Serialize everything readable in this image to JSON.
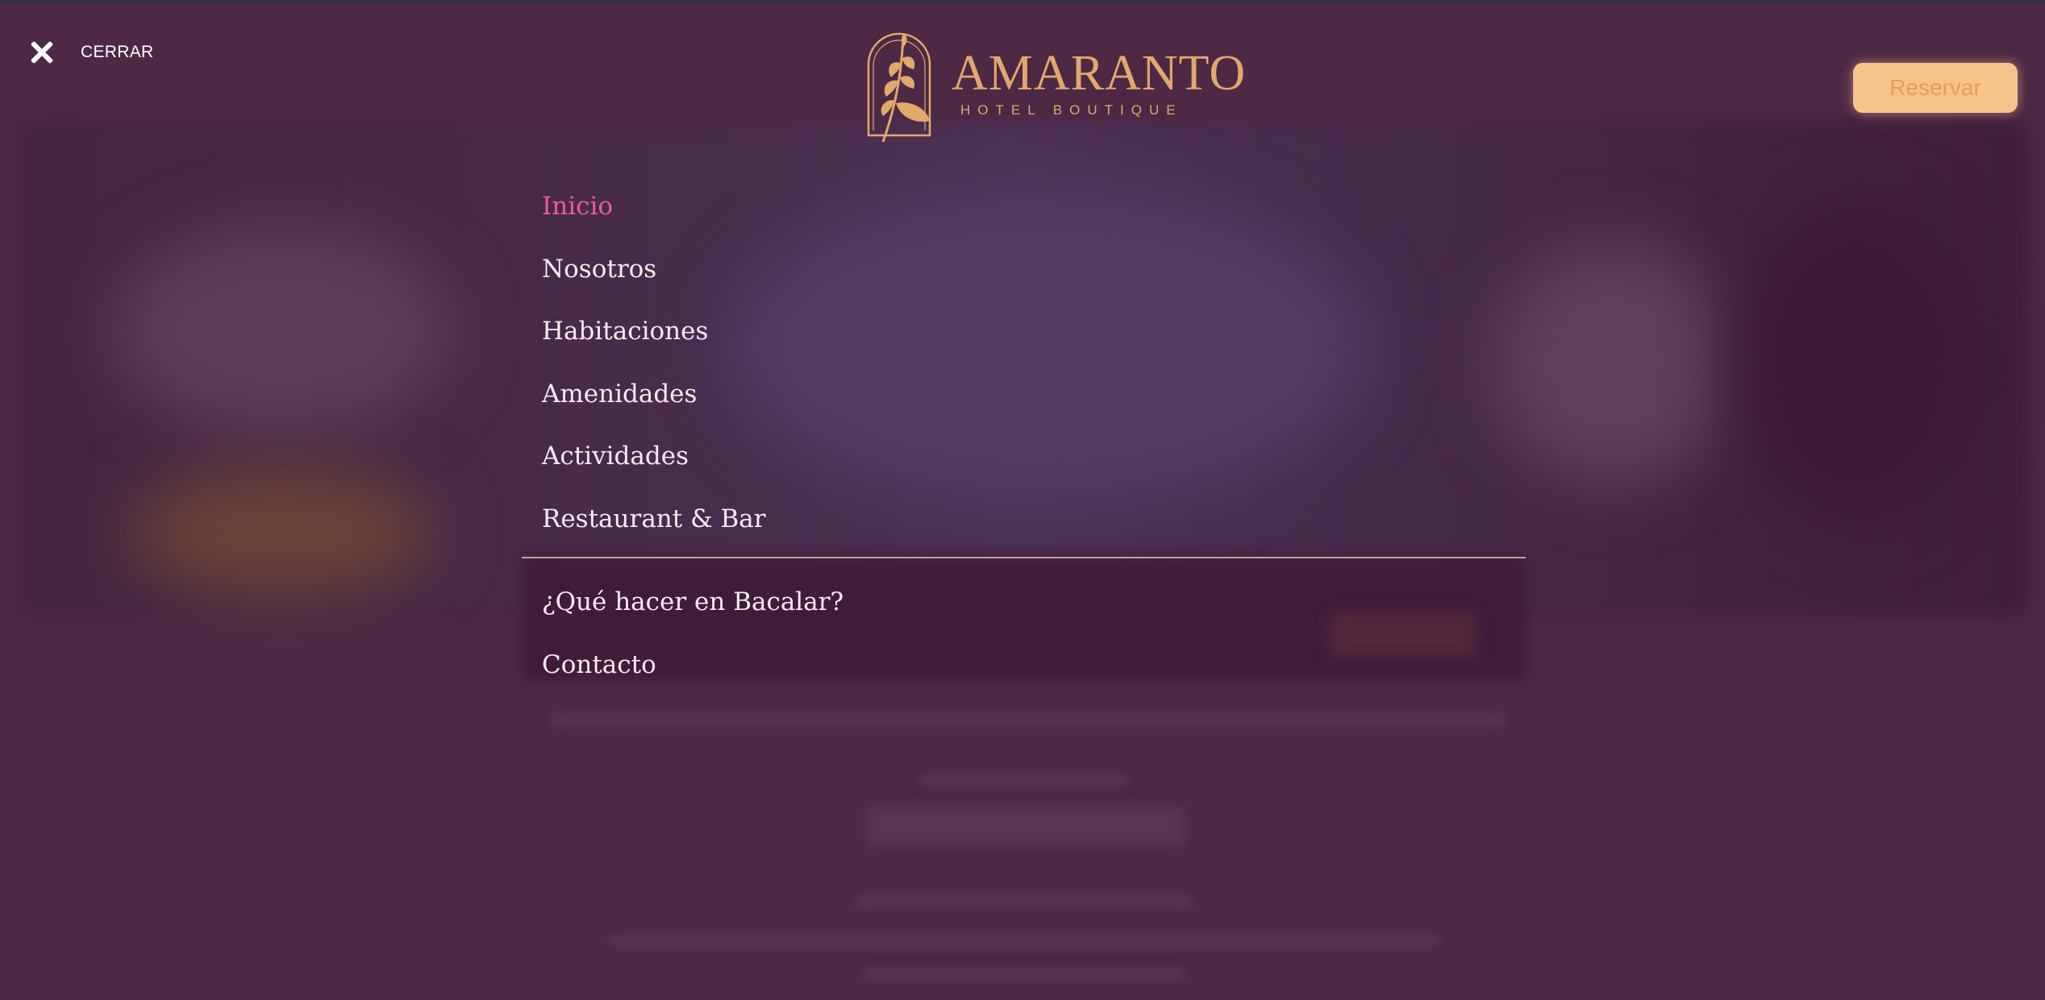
{
  "close": {
    "label": "CERRAR",
    "icon": "close-icon"
  },
  "logo": {
    "name": "AMARANTO",
    "subtitle": "HOTEL BOUTIQUE"
  },
  "reserve": {
    "label": "Reservar"
  },
  "menu": {
    "items": [
      {
        "label": "Inicio",
        "active": true
      },
      {
        "label": "Nosotros"
      },
      {
        "label": "Habitaciones"
      },
      {
        "label": "Amenidades"
      },
      {
        "label": "Actividades"
      },
      {
        "label": "Restaurant & Bar"
      }
    ],
    "secondary_items": [
      {
        "label": "¿Qué hacer en Bacalar?"
      },
      {
        "label": "Contacto"
      }
    ]
  },
  "colors": {
    "overlay": "#4d2945",
    "gold": "#e2a86c",
    "active": "#ec5a94",
    "button": "#f6c48a"
  }
}
